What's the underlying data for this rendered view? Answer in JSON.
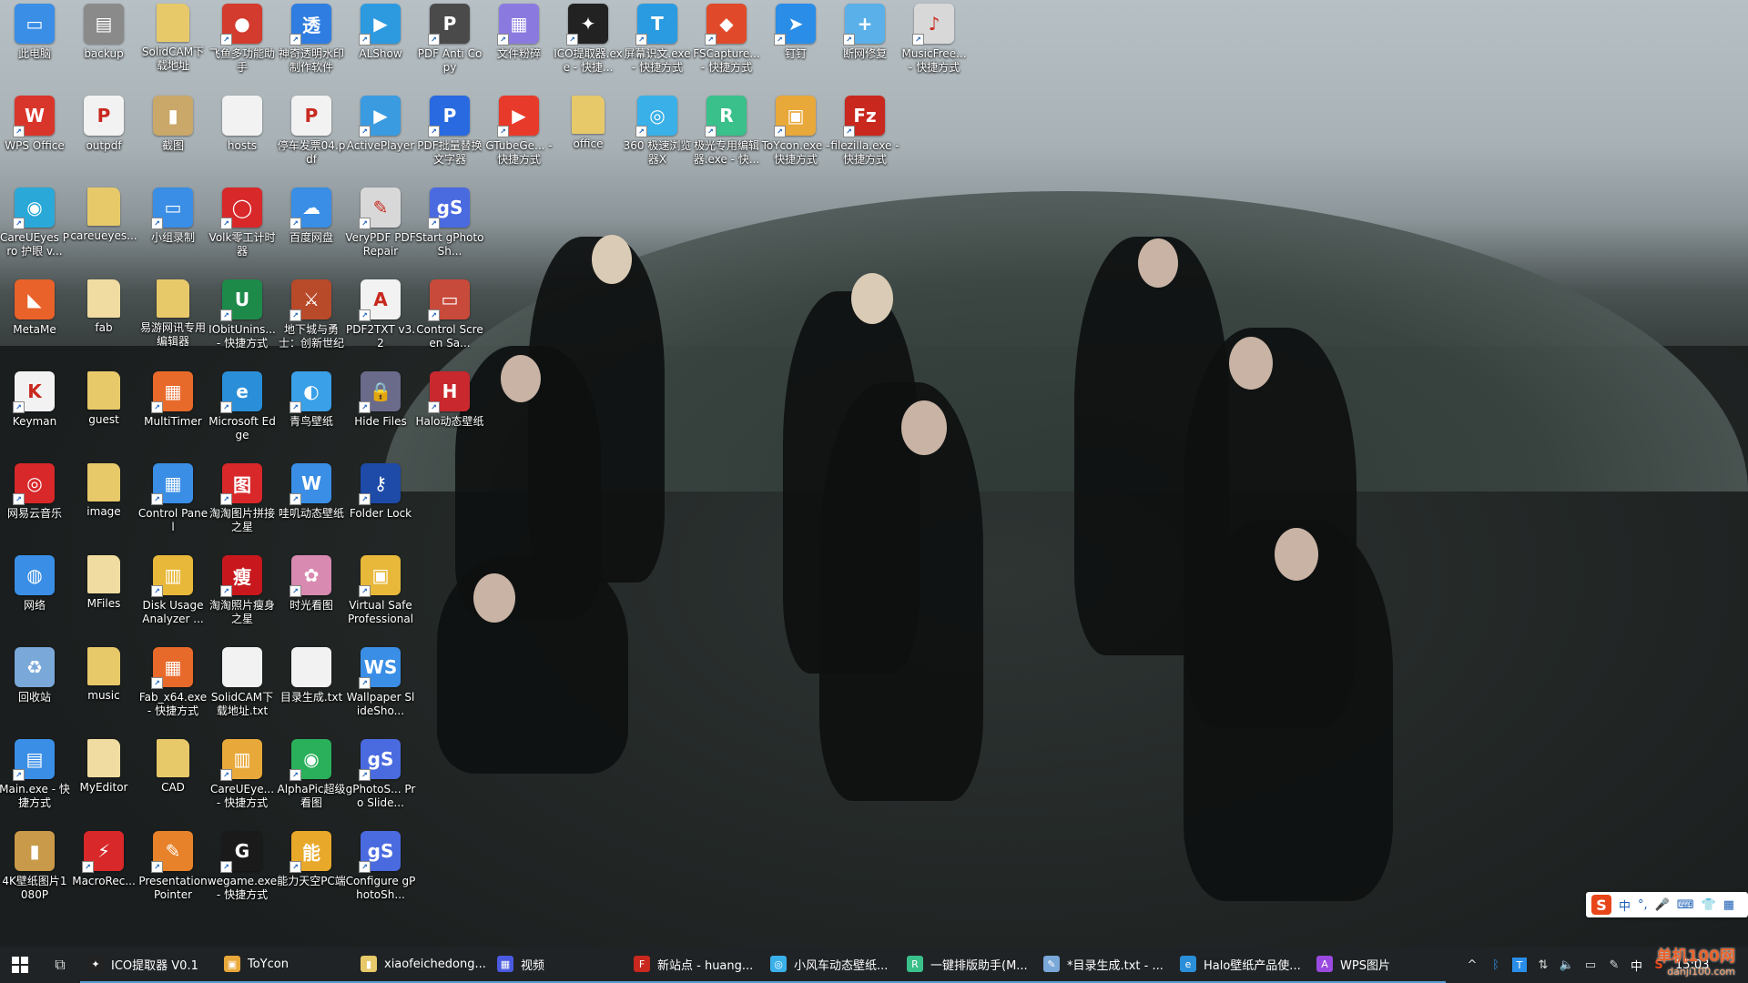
{
  "desktop": {
    "icons": [
      {
        "label": "此电脑",
        "color": "#3a8ee6",
        "glyph": "▭",
        "col": 0,
        "row": 0,
        "shortcut": false
      },
      {
        "label": "backup",
        "color": "#8a8a8a",
        "glyph": "▤",
        "col": 1,
        "row": 0,
        "shortcut": false
      },
      {
        "label": "SolidCAM下载地址",
        "color": "#e8c96a",
        "glyph": "",
        "col": 2,
        "row": 0,
        "shortcut": false
      },
      {
        "label": "飞鱼多功能助手",
        "color": "#d23b2e",
        "glyph": "●",
        "col": 3,
        "row": 0,
        "shortcut": true
      },
      {
        "label": "神奇透明水印制作软件",
        "color": "#2f7de1",
        "glyph": "透",
        "col": 4,
        "row": 0,
        "shortcut": true
      },
      {
        "label": "ALShow",
        "color": "#2d9ae0",
        "glyph": "▶",
        "col": 5,
        "row": 0,
        "shortcut": true
      },
      {
        "label": "PDF Anti Copy",
        "color": "#4a4a4a",
        "glyph": "P",
        "col": 6,
        "row": 0,
        "shortcut": true
      },
      {
        "label": "文件粉碎",
        "color": "#8a7ae0",
        "glyph": "▦",
        "col": 7,
        "row": 0,
        "shortcut": true
      },
      {
        "label": "ICO提取器.exe - 快捷...",
        "color": "#222222",
        "glyph": "✦",
        "col": 8,
        "row": 0,
        "shortcut": true
      },
      {
        "label": "屏幕识文.exe - 快捷方式",
        "color": "#2a9be0",
        "glyph": "T",
        "col": 9,
        "row": 0,
        "shortcut": true
      },
      {
        "label": "FSCapture... - 快捷方式",
        "color": "#e04a2a",
        "glyph": "◆",
        "col": 10,
        "row": 0,
        "shortcut": true
      },
      {
        "label": "钉钉",
        "color": "#2a8ee8",
        "glyph": "➤",
        "col": 11,
        "row": 0,
        "shortcut": true
      },
      {
        "label": "断网修复",
        "color": "#5ab0e8",
        "glyph": "+",
        "col": 12,
        "row": 0,
        "shortcut": true
      },
      {
        "label": "MusicFree... - 快捷方式",
        "color": "#d8d8d8",
        "glyph": "♪",
        "col": 13,
        "row": 0,
        "shortcut": true
      },
      {
        "label": "WPS Office",
        "color": "#d9362b",
        "glyph": "W",
        "col": 0,
        "row": 1,
        "shortcut": true
      },
      {
        "label": "outpdf",
        "color": "#f2f2f2",
        "glyph": "P",
        "col": 1,
        "row": 1,
        "shortcut": false
      },
      {
        "label": "截图",
        "color": "#c9a86a",
        "glyph": "▮",
        "col": 2,
        "row": 1,
        "shortcut": false
      },
      {
        "label": "hosts",
        "color": "#f2f2f2",
        "glyph": "",
        "col": 3,
        "row": 1,
        "shortcut": false
      },
      {
        "label": "停车发票04.pdf",
        "color": "#f2f2f2",
        "glyph": "P",
        "col": 4,
        "row": 1,
        "shortcut": false
      },
      {
        "label": "ActivePlayer",
        "color": "#3a9be0",
        "glyph": "▶",
        "col": 5,
        "row": 1,
        "shortcut": true
      },
      {
        "label": "PDF批量替换文字器",
        "color": "#2a6ae0",
        "glyph": "P",
        "col": 6,
        "row": 1,
        "shortcut": true
      },
      {
        "label": "GTubeGe... - 快捷方式",
        "color": "#e83a2a",
        "glyph": "▶",
        "col": 7,
        "row": 1,
        "shortcut": true
      },
      {
        "label": "office",
        "color": "#e8c96a",
        "glyph": "",
        "col": 8,
        "row": 1,
        "shortcut": false
      },
      {
        "label": "360 极速浏览器X",
        "color": "#3ab0e8",
        "glyph": "◎",
        "col": 9,
        "row": 1,
        "shortcut": true
      },
      {
        "label": "极光专用编辑器.exe - 快...",
        "color": "#3ac08a",
        "glyph": "R",
        "col": 10,
        "row": 1,
        "shortcut": true
      },
      {
        "label": "ToYcon.exe - 快捷方式",
        "color": "#e8a83a",
        "glyph": "▣",
        "col": 11,
        "row": 1,
        "shortcut": true
      },
      {
        "label": "filezilla.exe - 快捷方式",
        "color": "#c8281e",
        "glyph": "Fz",
        "col": 12,
        "row": 1,
        "shortcut": true
      },
      {
        "label": "CareUEyes Pro 护眼 v...",
        "color": "#2aa8d8",
        "glyph": "◉",
        "col": 0,
        "row": 2,
        "shortcut": true
      },
      {
        "label": "careueyes...",
        "color": "#e8c96a",
        "glyph": "",
        "col": 1,
        "row": 2,
        "shortcut": false
      },
      {
        "label": "小组录制",
        "color": "#3a8ee6",
        "glyph": "▭",
        "col": 2,
        "row": 2,
        "shortcut": true
      },
      {
        "label": "Volk零工计时器",
        "color": "#d8282a",
        "glyph": "◯",
        "col": 3,
        "row": 2,
        "shortcut": true
      },
      {
        "label": "百度网盘",
        "color": "#3a8ee6",
        "glyph": "☁",
        "col": 4,
        "row": 2,
        "shortcut": true
      },
      {
        "label": "VeryPDF PDF Repair",
        "color": "#d8d8d8",
        "glyph": "✎",
        "col": 5,
        "row": 2,
        "shortcut": true
      },
      {
        "label": "Start gPhotoSh...",
        "color": "#4a6ae0",
        "glyph": "gS",
        "col": 6,
        "row": 2,
        "shortcut": true
      },
      {
        "label": "MetaMe",
        "color": "#e8622a",
        "glyph": "◣",
        "col": 0,
        "row": 3,
        "shortcut": false
      },
      {
        "label": "fab",
        "color": "#f0dca0",
        "glyph": "",
        "col": 1,
        "row": 3,
        "shortcut": false
      },
      {
        "label": "易游网讯专用编辑器",
        "color": "#e8c96a",
        "glyph": "",
        "col": 2,
        "row": 3,
        "shortcut": false
      },
      {
        "label": "IObitUnins... - 快捷方式",
        "color": "#1e8a4a",
        "glyph": "U",
        "col": 3,
        "row": 3,
        "shortcut": true
      },
      {
        "label": "地下城与勇士：创新世纪",
        "color": "#b84a2a",
        "glyph": "⚔",
        "col": 4,
        "row": 3,
        "shortcut": true
      },
      {
        "label": "PDF2TXT v3.2",
        "color": "#f2f2f2",
        "glyph": "A",
        "col": 5,
        "row": 3,
        "shortcut": true
      },
      {
        "label": "Control Screen Sa...",
        "color": "#c84a3a",
        "glyph": "▭",
        "col": 6,
        "row": 3,
        "shortcut": true
      },
      {
        "label": "Keyman",
        "color": "#f2f2f2",
        "glyph": "K",
        "col": 0,
        "row": 4,
        "shortcut": true
      },
      {
        "label": "guest",
        "color": "#e8c96a",
        "glyph": "",
        "col": 1,
        "row": 4,
        "shortcut": false
      },
      {
        "label": "MultiTimer",
        "color": "#e86a2a",
        "glyph": "▦",
        "col": 2,
        "row": 4,
        "shortcut": true
      },
      {
        "label": "Microsoft Edge",
        "color": "#2a8ed8",
        "glyph": "e",
        "col": 3,
        "row": 4,
        "shortcut": true
      },
      {
        "label": "青鸟壁纸",
        "color": "#3aa0e8",
        "glyph": "◐",
        "col": 4,
        "row": 4,
        "shortcut": true
      },
      {
        "label": "Hide Files",
        "color": "#6a6a8a",
        "glyph": "🔒",
        "col": 5,
        "row": 4,
        "shortcut": true
      },
      {
        "label": "Halo动态壁纸",
        "color": "#c8282e",
        "glyph": "H",
        "col": 6,
        "row": 4,
        "shortcut": true
      },
      {
        "label": "网易云音乐",
        "color": "#d8282a",
        "glyph": "◎",
        "col": 0,
        "row": 5,
        "shortcut": true
      },
      {
        "label": "image",
        "color": "#e8c96a",
        "glyph": "",
        "col": 1,
        "row": 5,
        "shortcut": false
      },
      {
        "label": "Control Panel",
        "color": "#3a8ee6",
        "glyph": "▦",
        "col": 2,
        "row": 5,
        "shortcut": true
      },
      {
        "label": "淘淘图片拼接之星",
        "color": "#d8282a",
        "glyph": "图",
        "col": 3,
        "row": 5,
        "shortcut": true
      },
      {
        "label": "哇叽动态壁纸",
        "color": "#3a8ee6",
        "glyph": "W",
        "col": 4,
        "row": 5,
        "shortcut": true
      },
      {
        "label": "Folder Lock",
        "color": "#1e4aa8",
        "glyph": "⚷",
        "col": 5,
        "row": 5,
        "shortcut": true
      },
      {
        "label": "网络",
        "color": "#3a8ee6",
        "glyph": "◍",
        "col": 0,
        "row": 6,
        "shortcut": false
      },
      {
        "label": "MFiles",
        "color": "#f0dca0",
        "glyph": "",
        "col": 1,
        "row": 6,
        "shortcut": false
      },
      {
        "label": "Disk Usage Analyzer ...",
        "color": "#e8b83a",
        "glyph": "▥",
        "col": 2,
        "row": 6,
        "shortcut": true
      },
      {
        "label": "淘淘照片瘦身之星",
        "color": "#c8181e",
        "glyph": "瘦",
        "col": 3,
        "row": 6,
        "shortcut": true
      },
      {
        "label": "时光看图",
        "color": "#d88ab0",
        "glyph": "✿",
        "col": 4,
        "row": 6,
        "shortcut": true
      },
      {
        "label": "Virtual Safe Professional",
        "color": "#e8b83a",
        "glyph": "▣",
        "col": 5,
        "row": 6,
        "shortcut": true
      },
      {
        "label": "回收站",
        "color": "#7aa8d8",
        "glyph": "♻",
        "col": 0,
        "row": 7,
        "shortcut": false
      },
      {
        "label": "music",
        "color": "#e8c96a",
        "glyph": "",
        "col": 1,
        "row": 7,
        "shortcut": false
      },
      {
        "label": "Fab_x64.exe - 快捷方式",
        "color": "#e86a2a",
        "glyph": "▦",
        "col": 2,
        "row": 7,
        "shortcut": true
      },
      {
        "label": "SolidCAM下载地址.txt",
        "color": "#f2f2f2",
        "glyph": "",
        "col": 3,
        "row": 7,
        "shortcut": false
      },
      {
        "label": "目录生成.txt",
        "color": "#f2f2f2",
        "glyph": "",
        "col": 4,
        "row": 7,
        "shortcut": false
      },
      {
        "label": "Wallpaper SlideSho...",
        "color": "#3a8ee6",
        "glyph": "WS",
        "col": 5,
        "row": 7,
        "shortcut": true
      },
      {
        "label": "Main.exe - 快捷方式",
        "color": "#3a8ee6",
        "glyph": "▤",
        "col": 0,
        "row": 8,
        "shortcut": true
      },
      {
        "label": "MyEditor",
        "color": "#f0dca0",
        "glyph": "",
        "col": 1,
        "row": 8,
        "shortcut": false
      },
      {
        "label": "CAD",
        "color": "#e8c96a",
        "glyph": "",
        "col": 2,
        "row": 8,
        "shortcut": false
      },
      {
        "label": "CareUEye... - 快捷方式",
        "color": "#e8a83a",
        "glyph": "▥",
        "col": 3,
        "row": 8,
        "shortcut": true
      },
      {
        "label": "AlphaPic超级看图",
        "color": "#2ab05a",
        "glyph": "◉",
        "col": 4,
        "row": 8,
        "shortcut": true
      },
      {
        "label": "gPhotoS... Pro Slide...",
        "color": "#4a6ae0",
        "glyph": "gS",
        "col": 5,
        "row": 8,
        "shortcut": true
      },
      {
        "label": "4K壁纸图片1080P",
        "color": "#c89a4a",
        "glyph": "▮",
        "col": 0,
        "row": 9,
        "shortcut": false
      },
      {
        "label": "MacroRec...",
        "color": "#d8282a",
        "glyph": "⚡",
        "col": 1,
        "row": 9,
        "shortcut": true
      },
      {
        "label": "Presentation Pointer",
        "color": "#e8822a",
        "glyph": "✎",
        "col": 2,
        "row": 9,
        "shortcut": true
      },
      {
        "label": "wegame.exe - 快捷方式",
        "color": "#1a1a1a",
        "glyph": "G",
        "col": 3,
        "row": 9,
        "shortcut": true
      },
      {
        "label": "能力天空PC端",
        "color": "#e8a82a",
        "glyph": "能",
        "col": 4,
        "row": 9,
        "shortcut": true
      },
      {
        "label": "Configure gPhotoSh...",
        "color": "#4a6ae0",
        "glyph": "gS",
        "col": 5,
        "row": 9,
        "shortcut": true
      }
    ]
  },
  "ime": {
    "logo": "S",
    "mode": "中",
    "punct": "°,",
    "mic": "🎤",
    "keyboard": "⌨",
    "skin": "👕",
    "grid": "▦"
  },
  "taskbar": {
    "items": [
      {
        "label": "ICO提取器 V0.1",
        "color": "#222222",
        "glyph": "✦"
      },
      {
        "label": "ToYcon",
        "color": "#e8a83a",
        "glyph": "▣"
      },
      {
        "label": "xiaofeichedong...",
        "color": "#e8c96a",
        "glyph": "▮"
      },
      {
        "label": "视频",
        "color": "#4a5ae0",
        "glyph": "▦"
      },
      {
        "label": "新站点 - huang...",
        "color": "#c8281e",
        "glyph": "F"
      },
      {
        "label": "小风车动态壁纸...",
        "color": "#3ab0e8",
        "glyph": "◎"
      },
      {
        "label": "一键排版助手(M...",
        "color": "#3ac08a",
        "glyph": "R"
      },
      {
        "label": "*目录生成.txt - ...",
        "color": "#7aa8d8",
        "glyph": "✎"
      },
      {
        "label": "Halo壁纸产品使...",
        "color": "#2a8ed8",
        "glyph": "e"
      },
      {
        "label": "WPS图片",
        "color": "#9a4ae0",
        "glyph": "A"
      }
    ],
    "tray": {
      "chevron": "^",
      "lang": "中",
      "time": "15:03",
      "watermark": "单机100网",
      "watermark_url": "danji100.com"
    }
  }
}
